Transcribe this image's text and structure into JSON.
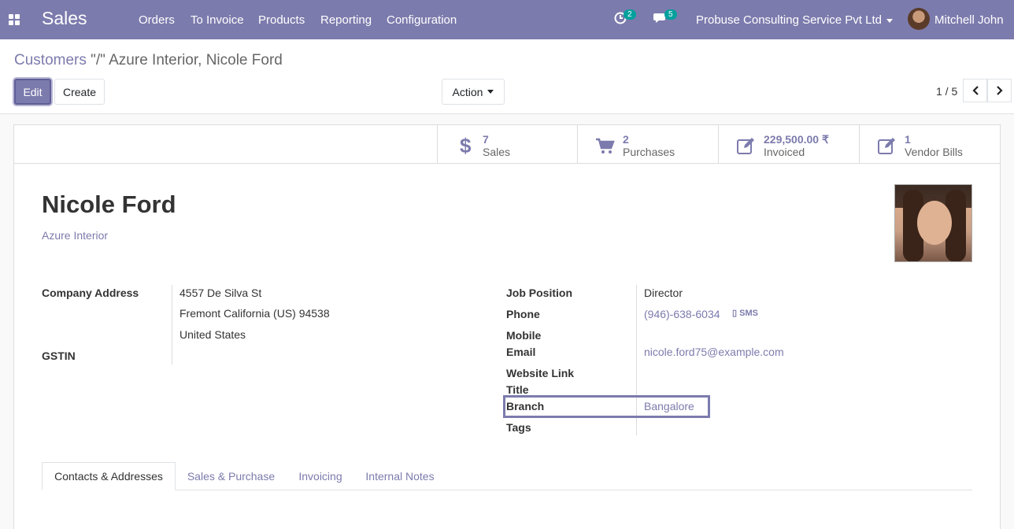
{
  "navbar": {
    "app_name": "Sales",
    "menu": [
      "Orders",
      "To Invoice",
      "Products",
      "Reporting",
      "Configuration"
    ],
    "activity_count": "2",
    "message_count": "5",
    "company": "Probuse Consulting Service Pvt Ltd",
    "user": "Mitchell John"
  },
  "control": {
    "breadcrumb_link": "Customers",
    "breadcrumb_current": "\"/\" Azure Interior, Nicole Ford",
    "edit_label": "Edit",
    "create_label": "Create",
    "action_label": "Action",
    "pager": "1 / 5"
  },
  "buttonbox": [
    {
      "icon": "dollar-icon",
      "value": "7",
      "label": "Sales"
    },
    {
      "icon": "cart-icon",
      "value": "2",
      "label": "Purchases"
    },
    {
      "icon": "edit-icon",
      "value": "229,500.00 ₹",
      "label": "Invoiced"
    },
    {
      "icon": "edit-icon",
      "value": "1",
      "label": "Vendor Bills"
    }
  ],
  "partner": {
    "name": "Nicole Ford",
    "company": "Azure Interior"
  },
  "left_fields": {
    "address_label": "Company Address",
    "street": "4557 De Silva St",
    "city_line": "Fremont  California (US)  94538",
    "country": "United States",
    "gstin_label": "GSTIN"
  },
  "right_fields": {
    "job_label": "Job Position",
    "job_value": "Director",
    "phone_label": "Phone",
    "phone_value": "(946)-638-6034",
    "sms_label": "SMS",
    "mobile_label": "Mobile",
    "email_label": "Email",
    "email_value": "nicole.ford75@example.com",
    "website_label": "Website Link",
    "title_label": "Title",
    "branch_label": "Branch",
    "branch_value": "Bangalore",
    "tags_label": "Tags"
  },
  "tabs": [
    "Contacts & Addresses",
    "Sales & Purchase",
    "Invoicing",
    "Internal Notes"
  ],
  "colors": {
    "brand": "#7c7bad",
    "badge": "#00a09d"
  }
}
